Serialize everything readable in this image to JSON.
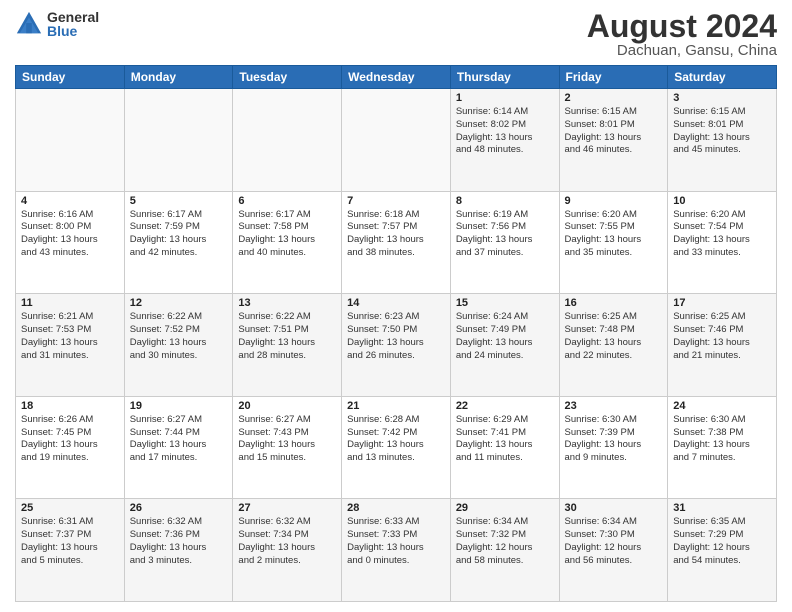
{
  "header": {
    "logo_general": "General",
    "logo_blue": "Blue",
    "month_year": "August 2024",
    "location": "Dachuan, Gansu, China"
  },
  "weekdays": [
    "Sunday",
    "Monday",
    "Tuesday",
    "Wednesday",
    "Thursday",
    "Friday",
    "Saturday"
  ],
  "weeks": [
    [
      {
        "day": "",
        "info": ""
      },
      {
        "day": "",
        "info": ""
      },
      {
        "day": "",
        "info": ""
      },
      {
        "day": "",
        "info": ""
      },
      {
        "day": "1",
        "info": "Sunrise: 6:14 AM\nSunset: 8:02 PM\nDaylight: 13 hours\nand 48 minutes."
      },
      {
        "day": "2",
        "info": "Sunrise: 6:15 AM\nSunset: 8:01 PM\nDaylight: 13 hours\nand 46 minutes."
      },
      {
        "day": "3",
        "info": "Sunrise: 6:15 AM\nSunset: 8:01 PM\nDaylight: 13 hours\nand 45 minutes."
      }
    ],
    [
      {
        "day": "4",
        "info": "Sunrise: 6:16 AM\nSunset: 8:00 PM\nDaylight: 13 hours\nand 43 minutes."
      },
      {
        "day": "5",
        "info": "Sunrise: 6:17 AM\nSunset: 7:59 PM\nDaylight: 13 hours\nand 42 minutes."
      },
      {
        "day": "6",
        "info": "Sunrise: 6:17 AM\nSunset: 7:58 PM\nDaylight: 13 hours\nand 40 minutes."
      },
      {
        "day": "7",
        "info": "Sunrise: 6:18 AM\nSunset: 7:57 PM\nDaylight: 13 hours\nand 38 minutes."
      },
      {
        "day": "8",
        "info": "Sunrise: 6:19 AM\nSunset: 7:56 PM\nDaylight: 13 hours\nand 37 minutes."
      },
      {
        "day": "9",
        "info": "Sunrise: 6:20 AM\nSunset: 7:55 PM\nDaylight: 13 hours\nand 35 minutes."
      },
      {
        "day": "10",
        "info": "Sunrise: 6:20 AM\nSunset: 7:54 PM\nDaylight: 13 hours\nand 33 minutes."
      }
    ],
    [
      {
        "day": "11",
        "info": "Sunrise: 6:21 AM\nSunset: 7:53 PM\nDaylight: 13 hours\nand 31 minutes."
      },
      {
        "day": "12",
        "info": "Sunrise: 6:22 AM\nSunset: 7:52 PM\nDaylight: 13 hours\nand 30 minutes."
      },
      {
        "day": "13",
        "info": "Sunrise: 6:22 AM\nSunset: 7:51 PM\nDaylight: 13 hours\nand 28 minutes."
      },
      {
        "day": "14",
        "info": "Sunrise: 6:23 AM\nSunset: 7:50 PM\nDaylight: 13 hours\nand 26 minutes."
      },
      {
        "day": "15",
        "info": "Sunrise: 6:24 AM\nSunset: 7:49 PM\nDaylight: 13 hours\nand 24 minutes."
      },
      {
        "day": "16",
        "info": "Sunrise: 6:25 AM\nSunset: 7:48 PM\nDaylight: 13 hours\nand 22 minutes."
      },
      {
        "day": "17",
        "info": "Sunrise: 6:25 AM\nSunset: 7:46 PM\nDaylight: 13 hours\nand 21 minutes."
      }
    ],
    [
      {
        "day": "18",
        "info": "Sunrise: 6:26 AM\nSunset: 7:45 PM\nDaylight: 13 hours\nand 19 minutes."
      },
      {
        "day": "19",
        "info": "Sunrise: 6:27 AM\nSunset: 7:44 PM\nDaylight: 13 hours\nand 17 minutes."
      },
      {
        "day": "20",
        "info": "Sunrise: 6:27 AM\nSunset: 7:43 PM\nDaylight: 13 hours\nand 15 minutes."
      },
      {
        "day": "21",
        "info": "Sunrise: 6:28 AM\nSunset: 7:42 PM\nDaylight: 13 hours\nand 13 minutes."
      },
      {
        "day": "22",
        "info": "Sunrise: 6:29 AM\nSunset: 7:41 PM\nDaylight: 13 hours\nand 11 minutes."
      },
      {
        "day": "23",
        "info": "Sunrise: 6:30 AM\nSunset: 7:39 PM\nDaylight: 13 hours\nand 9 minutes."
      },
      {
        "day": "24",
        "info": "Sunrise: 6:30 AM\nSunset: 7:38 PM\nDaylight: 13 hours\nand 7 minutes."
      }
    ],
    [
      {
        "day": "25",
        "info": "Sunrise: 6:31 AM\nSunset: 7:37 PM\nDaylight: 13 hours\nand 5 minutes."
      },
      {
        "day": "26",
        "info": "Sunrise: 6:32 AM\nSunset: 7:36 PM\nDaylight: 13 hours\nand 3 minutes."
      },
      {
        "day": "27",
        "info": "Sunrise: 6:32 AM\nSunset: 7:34 PM\nDaylight: 13 hours\nand 2 minutes."
      },
      {
        "day": "28",
        "info": "Sunrise: 6:33 AM\nSunset: 7:33 PM\nDaylight: 13 hours\nand 0 minutes."
      },
      {
        "day": "29",
        "info": "Sunrise: 6:34 AM\nSunset: 7:32 PM\nDaylight: 12 hours\nand 58 minutes."
      },
      {
        "day": "30",
        "info": "Sunrise: 6:34 AM\nSunset: 7:30 PM\nDaylight: 12 hours\nand 56 minutes."
      },
      {
        "day": "31",
        "info": "Sunrise: 6:35 AM\nSunset: 7:29 PM\nDaylight: 12 hours\nand 54 minutes."
      }
    ]
  ]
}
